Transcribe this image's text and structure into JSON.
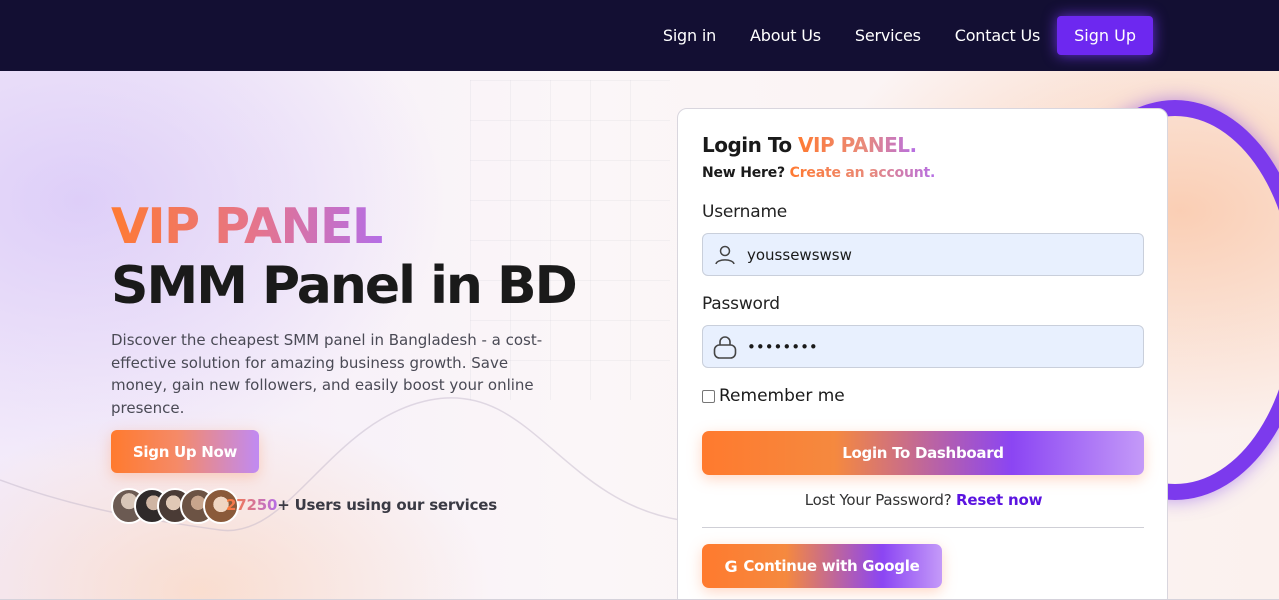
{
  "navbar": {
    "links": [
      "Sign in",
      "About Us",
      "Services",
      "Contact Us"
    ],
    "signup_label": "Sign Up"
  },
  "hero": {
    "brand": "VIP PANEL",
    "headline": "SMM Panel in BD",
    "description": "Discover the cheapest SMM panel in Bangladesh - a cost-effective solution for amazing business growth. Save money, gain new followers, and easily boost your online presence.",
    "cta_label": "Sign Up Now",
    "users_count": "27250",
    "users_suffix": "+ Users using our services"
  },
  "login": {
    "title_prefix": "Login To ",
    "title_brand": "VIP PANEL.",
    "new_here": "New Here? ",
    "create_account": "Create an account.",
    "username_label": "Username",
    "username_value": "youssewswsw",
    "password_label": "Password",
    "password_value": "••••••••",
    "remember_label": "Remember me",
    "remember_checked": false,
    "login_button": "Login To Dashboard",
    "lost_password": "Lost Your Password? ",
    "reset_link": "Reset now",
    "google_icon": "G",
    "google_button": "Continue with Google"
  },
  "colors": {
    "navbar_bg": "#130f33",
    "accent_purple": "#6d28f0",
    "gradient_orange": "#ff7a2e",
    "gradient_violet": "#8b45f3",
    "link_purple": "#5b14e0",
    "input_bg": "#e8f0fe"
  },
  "icons": {
    "username_field": "user-icon",
    "password_field": "lock-icon",
    "google_button": "google-icon"
  }
}
